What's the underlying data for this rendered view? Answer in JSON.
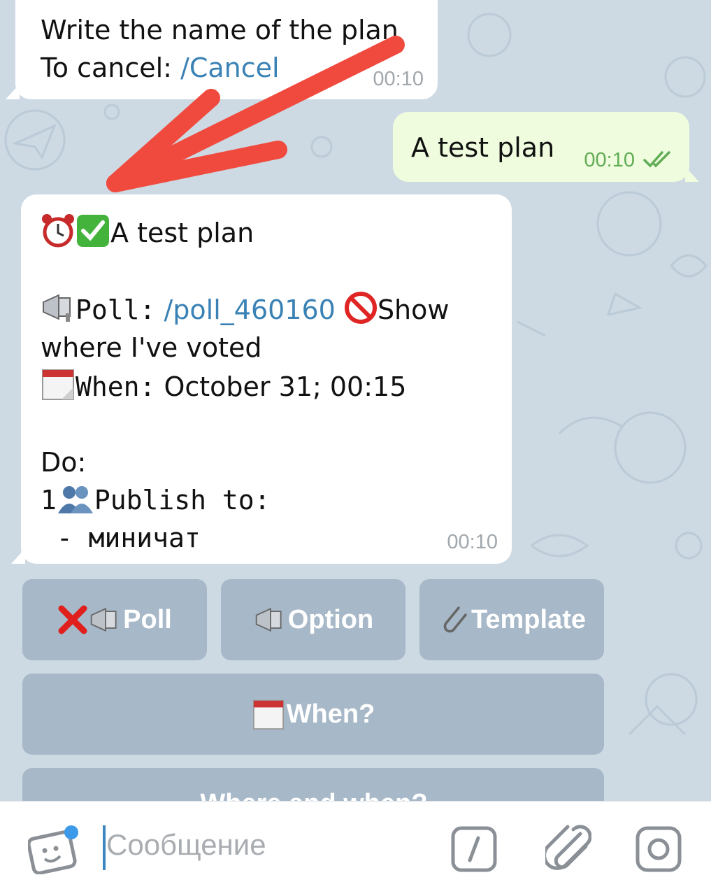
{
  "messages": {
    "bot_prompt": {
      "line1": "Write the name of the plan",
      "line2_prefix": "To cancel: ",
      "cancel_link": "/Cancel",
      "time": "00:10"
    },
    "user_reply": {
      "text": "A test plan",
      "time": "00:10",
      "status_icon": "double-check-icon"
    },
    "plan_card": {
      "title": "A test plan",
      "poll_label": "Poll:",
      "poll_link": "/poll_460160",
      "show_voted_1": "Show",
      "show_voted_2": "where I've voted",
      "when_label": "When:",
      "when_value": "October 31; 00:15",
      "do_label": "Do:",
      "step_number": "1",
      "publish_label": "Publish to:",
      "target_line": " - миничат",
      "time": "00:10"
    }
  },
  "keyboard": {
    "row1": [
      "Poll",
      "Option",
      "Template"
    ],
    "row2": [
      "When?"
    ],
    "row3_partial": "Where and when?"
  },
  "input": {
    "placeholder": "Сообщение"
  },
  "colors": {
    "wallpaper": "#cdd9e3",
    "outgoing_bubble": "#effdde",
    "link": "#3a82b5",
    "annotation_arrow": "#f04a3e"
  }
}
